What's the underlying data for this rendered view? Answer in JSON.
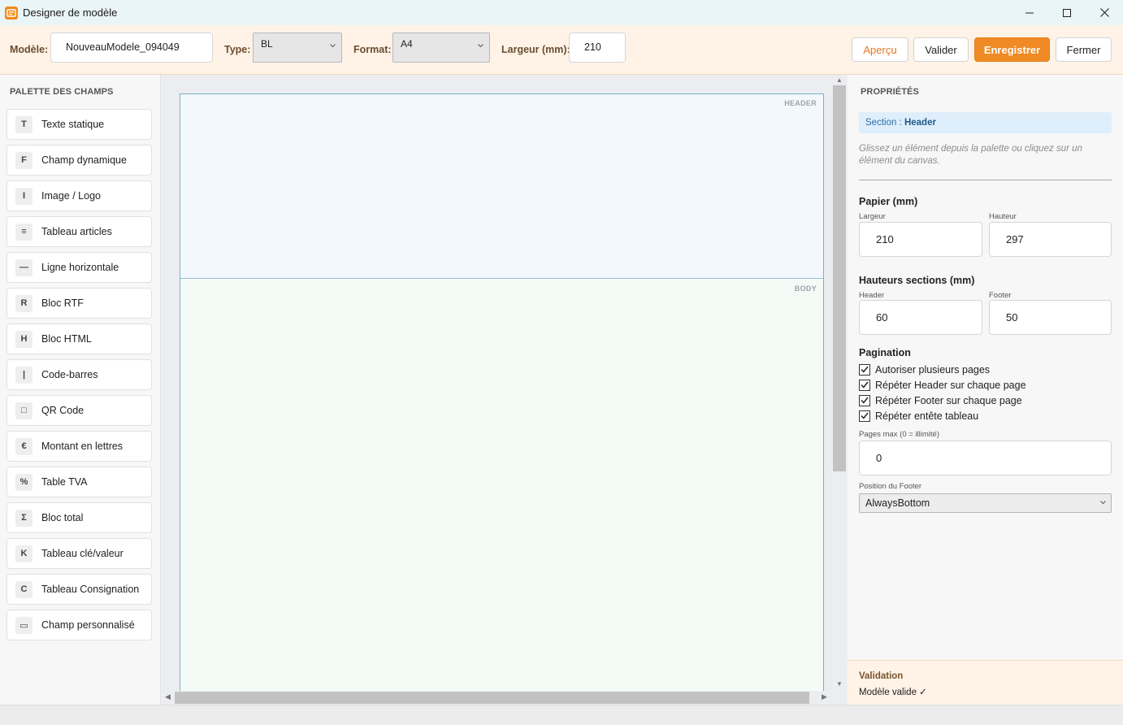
{
  "window": {
    "title": "Designer de modèle"
  },
  "toolbar": {
    "model_label": "Modèle:",
    "model_value": "NouveauModele_094049",
    "type_label": "Type:",
    "type_value": "BL",
    "format_label": "Format:",
    "format_value": "A4",
    "width_label": "Largeur (mm):",
    "width_value": "210",
    "preview_label": "Aperçu",
    "validate_label": "Valider",
    "save_label": "Enregistrer",
    "close_label": "Fermer"
  },
  "palette": {
    "title": "PALETTE DES CHAMPS",
    "items": [
      {
        "badge": "T",
        "label": "Texte statique"
      },
      {
        "badge": "F",
        "label": "Champ dynamique"
      },
      {
        "badge": "I",
        "label": "Image / Logo"
      },
      {
        "badge": "≡",
        "label": "Tableau articles"
      },
      {
        "badge": "—",
        "label": "Ligne horizontale"
      },
      {
        "badge": "R",
        "label": "Bloc RTF"
      },
      {
        "badge": "H",
        "label": "Bloc HTML"
      },
      {
        "badge": "|",
        "label": "Code-barres"
      },
      {
        "badge": "□",
        "label": "QR Code"
      },
      {
        "badge": "€",
        "label": "Montant en lettres"
      },
      {
        "badge": "%",
        "label": "Table TVA"
      },
      {
        "badge": "Σ",
        "label": "Bloc total"
      },
      {
        "badge": "K",
        "label": "Tableau clé/valeur"
      },
      {
        "badge": "C",
        "label": "Tableau Consignation"
      },
      {
        "badge": "▭",
        "label": "Champ personnalisé"
      }
    ]
  },
  "canvas": {
    "header_tag": "HEADER",
    "body_tag": "BODY"
  },
  "properties": {
    "title": "PROPRIÉTÉS",
    "section_prefix": "Section :",
    "section_name": "Header",
    "hint": "Glissez un élément depuis la palette ou cliquez sur un élément du canvas.",
    "paper_title": "Papier (mm)",
    "paper_width_label": "Largeur",
    "paper_width_value": "210",
    "paper_height_label": "Hauteur",
    "paper_height_value": "297",
    "sections_title": "Hauteurs sections (mm)",
    "header_label": "Header",
    "header_value": "60",
    "footer_label": "Footer",
    "footer_value": "50",
    "pagination_title": "Pagination",
    "checks": [
      {
        "label": "Autoriser plusieurs pages",
        "checked": true
      },
      {
        "label": "Répéter Header sur chaque page",
        "checked": true
      },
      {
        "label": "Répéter Footer sur chaque page",
        "checked": true
      },
      {
        "label": "Répéter entête tableau",
        "checked": true
      }
    ],
    "max_pages_label": "Pages max (0 = illimité)",
    "max_pages_value": "0",
    "footer_position_label": "Position du Footer",
    "footer_position_value": "AlwaysBottom"
  },
  "validation": {
    "title": "Validation",
    "status": "Modèle valide ✓"
  },
  "colors": {
    "accent": "#f08a24",
    "toolbar_bg": "#fef3e6",
    "header_section_bg": "#f3f8fd",
    "body_section_bg": "#f4faf6"
  }
}
